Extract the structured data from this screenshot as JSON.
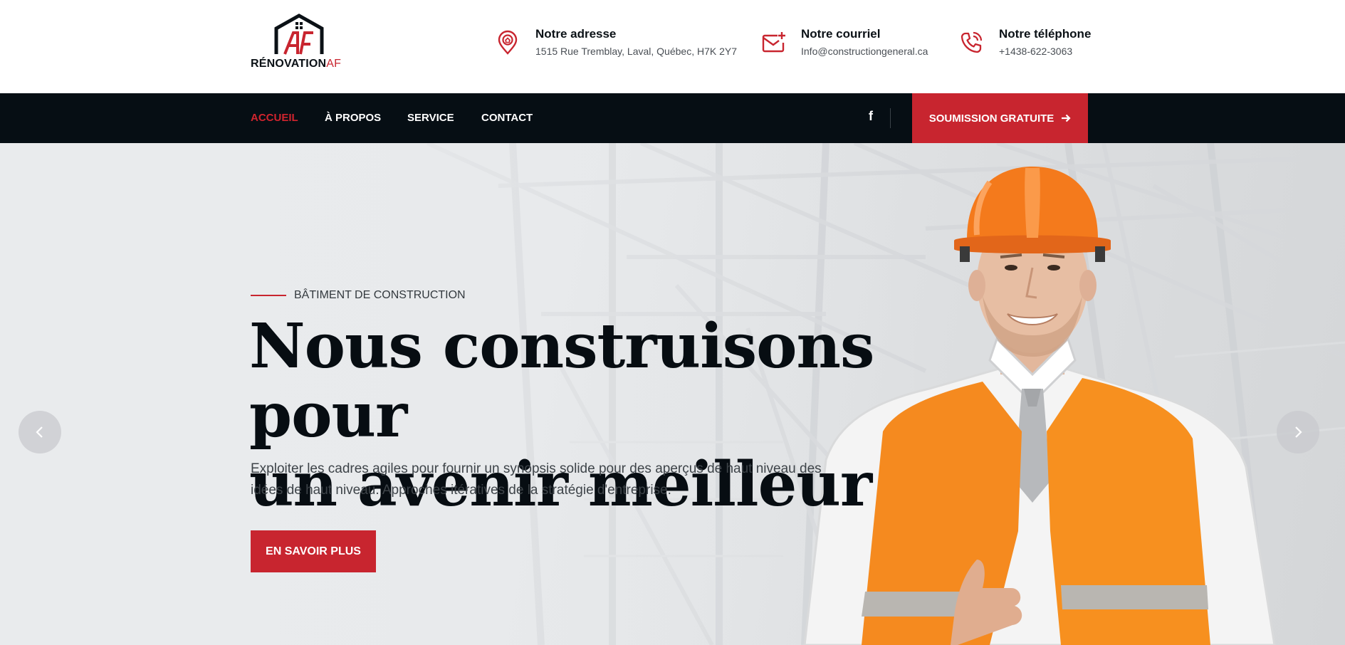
{
  "brand": {
    "name_main": "RÉNOVATION",
    "name_accent": "AF",
    "logo_icon": "house-logo-icon"
  },
  "contacts": [
    {
      "icon": "location-pin-icon",
      "label": "Notre adresse",
      "value": "1515 Rue Tremblay, Laval, Québec, H7K 2Y7"
    },
    {
      "icon": "mail-plus-icon",
      "label": "Notre courriel",
      "value": "Info@constructiongeneral.ca"
    },
    {
      "icon": "phone-ringing-icon",
      "label": "Notre téléphone",
      "value": "+1438-622-3063"
    }
  ],
  "nav": {
    "items": [
      {
        "label": "ACCUEIL",
        "active": true
      },
      {
        "label": "À PROPOS",
        "active": false
      },
      {
        "label": "SERVICE",
        "active": false
      },
      {
        "label": "CONTACT",
        "active": false
      }
    ],
    "social_icon": "facebook-icon",
    "social_glyph": "f",
    "cta_label": "SOUMISSION GRATUITE",
    "cta_icon": "arrow-right-icon"
  },
  "hero": {
    "subtitle": "BÂTIMENT DE CONSTRUCTION",
    "title_line1": "Nous construisons pour",
    "title_line2_start": "un avenir",
    "title_highlight": "meilleur",
    "description": "Exploiter les cadres agiles pour fournir un synopsis solide pour des aperçus de haut niveau des idées de haut niveau. Approches itératives de la stratégie d'entreprise.",
    "button_label": "EN SAVOIR PLUS",
    "prev_icon": "chevron-left-icon",
    "next_icon": "chevron-right-icon"
  },
  "colors": {
    "accent": "#c8252f",
    "nav_bg": "#060e14",
    "text_dark": "#070d12"
  }
}
